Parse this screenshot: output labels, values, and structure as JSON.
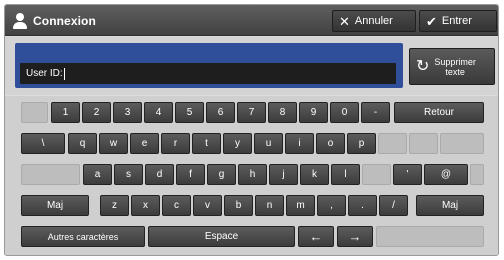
{
  "header": {
    "title": "Connexion",
    "cancel_label": "Annuler",
    "ok_label": "Entrer"
  },
  "input": {
    "label": "User ID:",
    "value": ""
  },
  "clear_button": {
    "line1": "Supprimer",
    "line2": "texte"
  },
  "keyboard": {
    "row1": [
      "1",
      "2",
      "3",
      "4",
      "5",
      "6",
      "7",
      "8",
      "9",
      "0",
      "-"
    ],
    "row1_return": "Retour",
    "row2": [
      "\\",
      "q",
      "w",
      "e",
      "r",
      "t",
      "y",
      "u",
      "i",
      "o",
      "p"
    ],
    "row3": [
      "a",
      "s",
      "d",
      "f",
      "g",
      "h",
      "j",
      "k",
      "l"
    ],
    "row3_extra": [
      "'",
      "@"
    ],
    "row4_shift_left": "Maj",
    "row4": [
      "z",
      "x",
      "c",
      "v",
      "b",
      "n",
      "m",
      ",",
      ".",
      "/"
    ],
    "row4_shift_right": "Maj",
    "row5_other": "Autres caractères",
    "row5_space": "Espace",
    "row5_left": "←",
    "row5_right": "→"
  },
  "colors": {
    "header_bg": "#4a4a4a",
    "field_frame": "#2f4f9a",
    "key_bg": "#474747",
    "panel_bg": "#dcdcdc"
  }
}
